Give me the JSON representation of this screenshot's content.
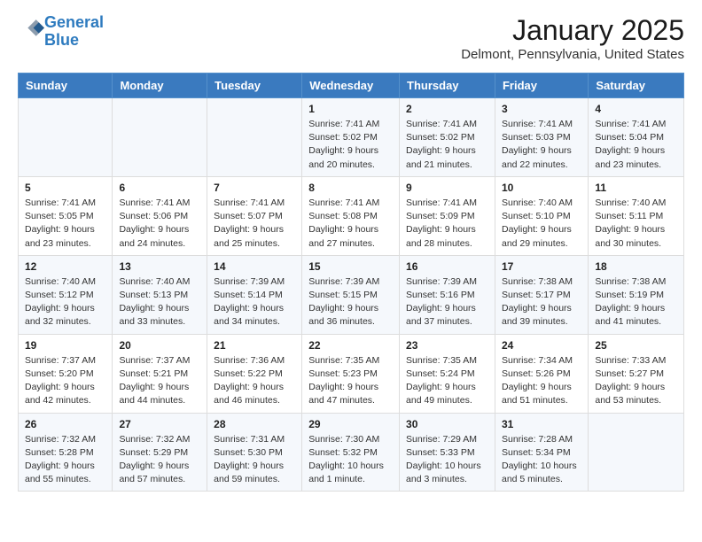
{
  "header": {
    "logo_line1": "General",
    "logo_line2": "Blue",
    "month": "January 2025",
    "location": "Delmont, Pennsylvania, United States"
  },
  "weekdays": [
    "Sunday",
    "Monday",
    "Tuesday",
    "Wednesday",
    "Thursday",
    "Friday",
    "Saturday"
  ],
  "weeks": [
    [
      {
        "day": "",
        "info": ""
      },
      {
        "day": "",
        "info": ""
      },
      {
        "day": "",
        "info": ""
      },
      {
        "day": "1",
        "info": "Sunrise: 7:41 AM\nSunset: 5:02 PM\nDaylight: 9 hours and 20 minutes."
      },
      {
        "day": "2",
        "info": "Sunrise: 7:41 AM\nSunset: 5:02 PM\nDaylight: 9 hours and 21 minutes."
      },
      {
        "day": "3",
        "info": "Sunrise: 7:41 AM\nSunset: 5:03 PM\nDaylight: 9 hours and 22 minutes."
      },
      {
        "day": "4",
        "info": "Sunrise: 7:41 AM\nSunset: 5:04 PM\nDaylight: 9 hours and 23 minutes."
      }
    ],
    [
      {
        "day": "5",
        "info": "Sunrise: 7:41 AM\nSunset: 5:05 PM\nDaylight: 9 hours and 23 minutes."
      },
      {
        "day": "6",
        "info": "Sunrise: 7:41 AM\nSunset: 5:06 PM\nDaylight: 9 hours and 24 minutes."
      },
      {
        "day": "7",
        "info": "Sunrise: 7:41 AM\nSunset: 5:07 PM\nDaylight: 9 hours and 25 minutes."
      },
      {
        "day": "8",
        "info": "Sunrise: 7:41 AM\nSunset: 5:08 PM\nDaylight: 9 hours and 27 minutes."
      },
      {
        "day": "9",
        "info": "Sunrise: 7:41 AM\nSunset: 5:09 PM\nDaylight: 9 hours and 28 minutes."
      },
      {
        "day": "10",
        "info": "Sunrise: 7:40 AM\nSunset: 5:10 PM\nDaylight: 9 hours and 29 minutes."
      },
      {
        "day": "11",
        "info": "Sunrise: 7:40 AM\nSunset: 5:11 PM\nDaylight: 9 hours and 30 minutes."
      }
    ],
    [
      {
        "day": "12",
        "info": "Sunrise: 7:40 AM\nSunset: 5:12 PM\nDaylight: 9 hours and 32 minutes."
      },
      {
        "day": "13",
        "info": "Sunrise: 7:40 AM\nSunset: 5:13 PM\nDaylight: 9 hours and 33 minutes."
      },
      {
        "day": "14",
        "info": "Sunrise: 7:39 AM\nSunset: 5:14 PM\nDaylight: 9 hours and 34 minutes."
      },
      {
        "day": "15",
        "info": "Sunrise: 7:39 AM\nSunset: 5:15 PM\nDaylight: 9 hours and 36 minutes."
      },
      {
        "day": "16",
        "info": "Sunrise: 7:39 AM\nSunset: 5:16 PM\nDaylight: 9 hours and 37 minutes."
      },
      {
        "day": "17",
        "info": "Sunrise: 7:38 AM\nSunset: 5:17 PM\nDaylight: 9 hours and 39 minutes."
      },
      {
        "day": "18",
        "info": "Sunrise: 7:38 AM\nSunset: 5:19 PM\nDaylight: 9 hours and 41 minutes."
      }
    ],
    [
      {
        "day": "19",
        "info": "Sunrise: 7:37 AM\nSunset: 5:20 PM\nDaylight: 9 hours and 42 minutes."
      },
      {
        "day": "20",
        "info": "Sunrise: 7:37 AM\nSunset: 5:21 PM\nDaylight: 9 hours and 44 minutes."
      },
      {
        "day": "21",
        "info": "Sunrise: 7:36 AM\nSunset: 5:22 PM\nDaylight: 9 hours and 46 minutes."
      },
      {
        "day": "22",
        "info": "Sunrise: 7:35 AM\nSunset: 5:23 PM\nDaylight: 9 hours and 47 minutes."
      },
      {
        "day": "23",
        "info": "Sunrise: 7:35 AM\nSunset: 5:24 PM\nDaylight: 9 hours and 49 minutes."
      },
      {
        "day": "24",
        "info": "Sunrise: 7:34 AM\nSunset: 5:26 PM\nDaylight: 9 hours and 51 minutes."
      },
      {
        "day": "25",
        "info": "Sunrise: 7:33 AM\nSunset: 5:27 PM\nDaylight: 9 hours and 53 minutes."
      }
    ],
    [
      {
        "day": "26",
        "info": "Sunrise: 7:32 AM\nSunset: 5:28 PM\nDaylight: 9 hours and 55 minutes."
      },
      {
        "day": "27",
        "info": "Sunrise: 7:32 AM\nSunset: 5:29 PM\nDaylight: 9 hours and 57 minutes."
      },
      {
        "day": "28",
        "info": "Sunrise: 7:31 AM\nSunset: 5:30 PM\nDaylight: 9 hours and 59 minutes."
      },
      {
        "day": "29",
        "info": "Sunrise: 7:30 AM\nSunset: 5:32 PM\nDaylight: 10 hours and 1 minute."
      },
      {
        "day": "30",
        "info": "Sunrise: 7:29 AM\nSunset: 5:33 PM\nDaylight: 10 hours and 3 minutes."
      },
      {
        "day": "31",
        "info": "Sunrise: 7:28 AM\nSunset: 5:34 PM\nDaylight: 10 hours and 5 minutes."
      },
      {
        "day": "",
        "info": ""
      }
    ]
  ]
}
